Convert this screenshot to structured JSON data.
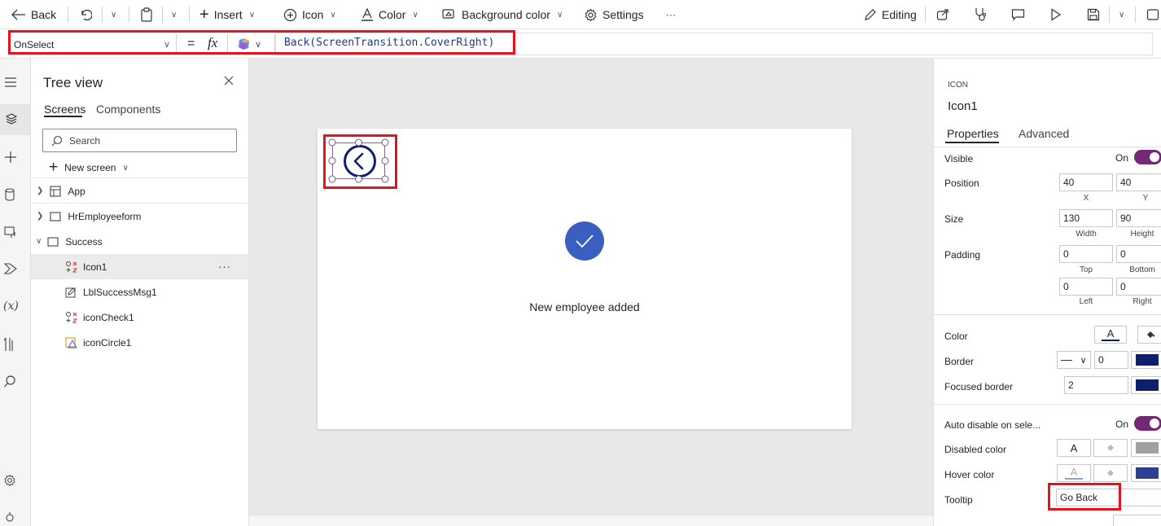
{
  "toolbar": {
    "back": "Back",
    "insert": "Insert",
    "icon": "Icon",
    "color": "Color",
    "background_color": "Background color",
    "settings": "Settings",
    "more": "···",
    "editing": "Editing"
  },
  "formula": {
    "property": "OnSelect",
    "equals": "=",
    "fx": "fx",
    "expression": "Back(ScreenTransition.CoverRight)"
  },
  "tree": {
    "title": "Tree view",
    "tabs": [
      "Screens",
      "Components"
    ],
    "search_placeholder": "Search",
    "new_screen": "New screen",
    "items": [
      {
        "label": "App"
      },
      {
        "label": "HrEmployeeform"
      },
      {
        "label": "Success"
      },
      {
        "label": "Icon1",
        "more": "···"
      },
      {
        "label": "LblSuccessMsg1"
      },
      {
        "label": "iconCheck1"
      },
      {
        "label": "iconCircle1"
      }
    ]
  },
  "canvas": {
    "message": "New employee added"
  },
  "props": {
    "type": "ICON",
    "name": "Icon1",
    "tabs": [
      "Properties",
      "Advanced"
    ],
    "visible_label": "Visible",
    "visible_value": "On",
    "position_label": "Position",
    "position_x": "40",
    "position_y": "40",
    "x_label": "X",
    "y_label": "Y",
    "size_label": "Size",
    "width": "130",
    "height": "90",
    "width_label": "Width",
    "height_label": "Height",
    "padding_label": "Padding",
    "padding_top": "0",
    "padding_bottom": "0",
    "padding_left": "0",
    "padding_right": "0",
    "top_label": "Top",
    "bottom_label": "Bottom",
    "left_label": "Left",
    "right_label": "Right",
    "color_label": "Color",
    "border_label": "Border",
    "border_width": "0",
    "focused_border_label": "Focused border",
    "focused_border_width": "2",
    "auto_disable_label": "Auto disable on sele...",
    "auto_disable_value": "On",
    "disabled_color_label": "Disabled color",
    "hover_color_label": "Hover color",
    "tooltip_label": "Tooltip",
    "tooltip_value": "Go Back",
    "glyph_a": "A"
  },
  "colors": {
    "accent": "#742774",
    "icon_navy": "#0f1e6e",
    "check_blue": "#3b5fc0",
    "highlight_red": "#e3151a"
  }
}
